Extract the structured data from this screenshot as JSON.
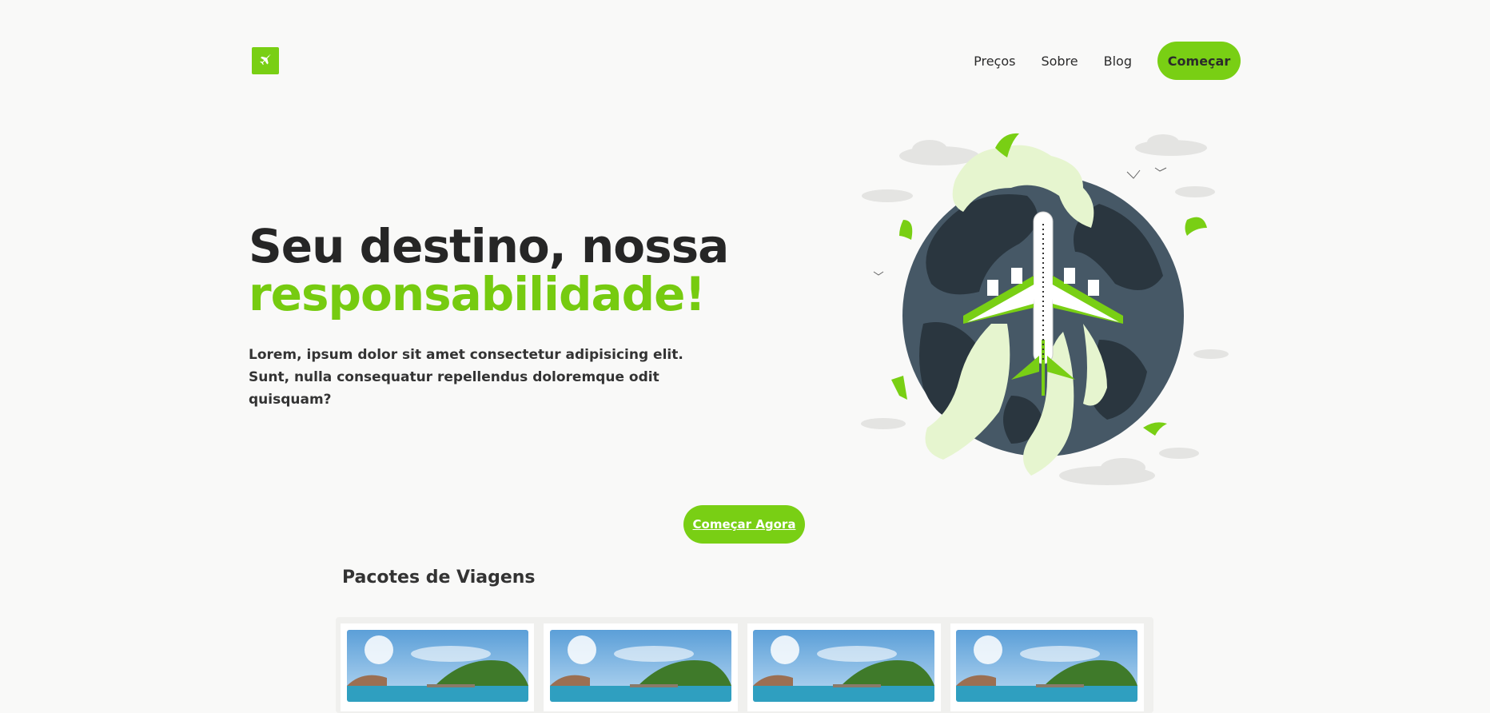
{
  "header": {
    "logo_icon": "plane-icon",
    "nav": [
      "Preços",
      "Sobre",
      "Blog"
    ],
    "cta_label": "Começar"
  },
  "hero": {
    "title_line1": "Seu destino, nossa",
    "title_line2": "responsabilidade!",
    "subtitle_line1": "Lorem, ipsum dolor sit amet consectetur adipisicing elit.",
    "subtitle_line2": "Sunt, nulla consequatur repellendus doloremque odit quisquam?",
    "illustration": "airplane-over-globe-illustration",
    "cta_label": "Começar Agora"
  },
  "packages": {
    "title": "Pacotes de Viagens",
    "cards": [
      {
        "image": "beach-pier-photo"
      },
      {
        "image": "beach-pier-photo"
      },
      {
        "image": "beach-pier-photo"
      },
      {
        "image": "beach-pier-photo"
      }
    ]
  },
  "colors": {
    "accent": "#79cf14",
    "background": "#f9f9f8",
    "text": "#2b2b2b"
  }
}
